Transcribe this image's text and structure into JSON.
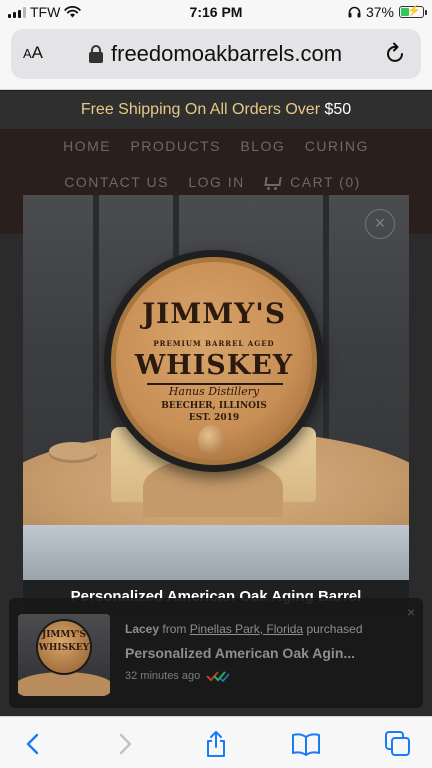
{
  "status_bar": {
    "carrier": "TFW",
    "time": "7:16 PM",
    "battery_percent": "37%",
    "battery_level": 0.37
  },
  "address_bar": {
    "text_size_label": "AA",
    "domain": "freedomoakbarrels.com"
  },
  "site": {
    "promo_text": "Free Shipping On All Orders Over",
    "promo_amount": "$50",
    "nav": {
      "home": "HOME",
      "products": "PRODUCTS",
      "blog": "BLOG",
      "curing": "CURING",
      "contact": "CONTACT US",
      "login": "LOG IN",
      "cart": "CART (0)"
    }
  },
  "lightbox": {
    "caption": "Personalized American Oak Aging Barrel",
    "close_symbol": "×",
    "barrel_engraving": {
      "name": "JIMMY'S",
      "subtitle": "PREMIUM BARREL AGED",
      "spirit": "WHISKEY",
      "distillery": "Hanus Distillery",
      "city": "BEECHER, ILLINOIS",
      "est": "EST. 2019"
    }
  },
  "notification": {
    "buyer": "Lacey",
    "from_word": "from",
    "location": "Pinellas Park, Florida",
    "action": "purchased",
    "product": "Personalized American Oak Agin...",
    "time_ago": "32 minutes ago",
    "close_symbol": "×",
    "thumb_text_1": "JIMMY'S",
    "thumb_text_2": "WHISKEY"
  },
  "toolbar": {
    "icons": [
      "back-icon",
      "forward-icon",
      "share-icon",
      "bookmarks-icon",
      "tabs-icon"
    ]
  },
  "colors": {
    "promo_text": "#e7c986",
    "nav_text": "#6a6a6a",
    "ios_blue": "#1a7cf5",
    "battery_green": "#34c759"
  }
}
